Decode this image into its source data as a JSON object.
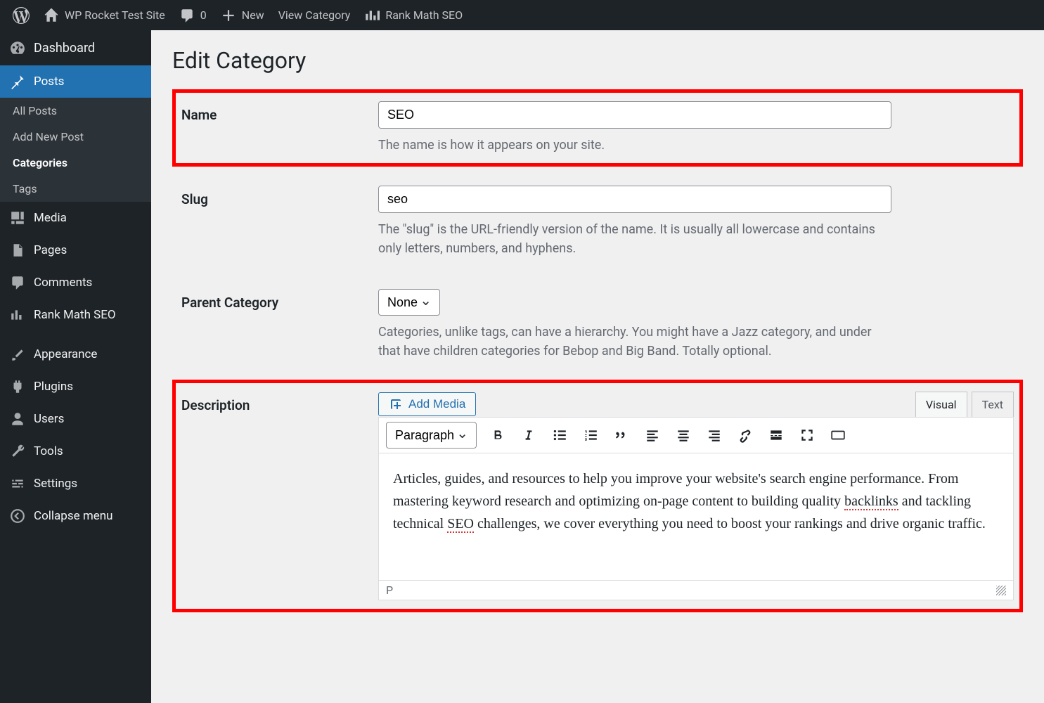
{
  "adminbar": {
    "site_title": "WP Rocket Test Site",
    "comment_count": "0",
    "new_label": "New",
    "view_category": "View Category",
    "rank_math": "Rank Math SEO"
  },
  "sidebar": {
    "dashboard": "Dashboard",
    "posts": "Posts",
    "posts_sub": {
      "all": "All Posts",
      "add": "Add New Post",
      "categories": "Categories",
      "tags": "Tags"
    },
    "media": "Media",
    "pages": "Pages",
    "comments": "Comments",
    "rank_math": "Rank Math SEO",
    "appearance": "Appearance",
    "plugins": "Plugins",
    "users": "Users",
    "tools": "Tools",
    "settings": "Settings",
    "collapse": "Collapse menu"
  },
  "page": {
    "title": "Edit Category",
    "name": {
      "label": "Name",
      "value": "SEO",
      "help": "The name is how it appears on your site."
    },
    "slug": {
      "label": "Slug",
      "value": "seo",
      "help": "The \"slug\" is the URL-friendly version of the name. It is usually all lowercase and contains only letters, numbers, and hyphens."
    },
    "parent": {
      "label": "Parent Category",
      "value": "None",
      "help": "Categories, unlike tags, can have a hierarchy. You might have a Jazz category, and under that have children categories for Bebop and Big Band. Totally optional."
    },
    "description": {
      "label": "Description",
      "add_media": "Add Media",
      "tab_visual": "Visual",
      "tab_text": "Text",
      "format": "Paragraph",
      "content_prefix": "Articles, guides, and resources to help you improve your website's search engine performance. From mastering keyword research and optimizing on-page content to building quality ",
      "content_w1": "backlinks",
      "content_mid": " and tackling technical ",
      "content_w2": "SEO",
      "content_suffix": " challenges, we cover everything you need to boost your rankings and drive organic traffic.",
      "status_path": "P"
    }
  }
}
